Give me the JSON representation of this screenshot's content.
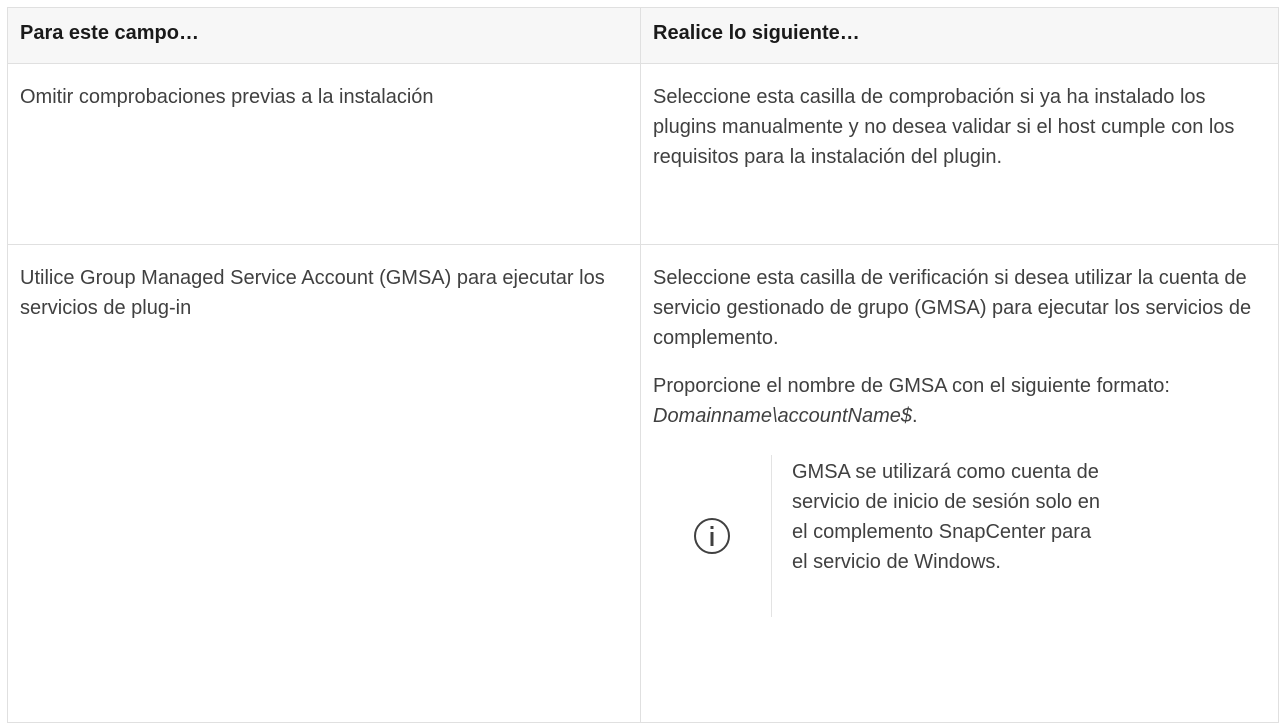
{
  "table": {
    "headers": [
      "Para este campo…",
      "Realice lo siguiente…"
    ],
    "rows": [
      {
        "field": "Omitir comprobaciones previas a la instalación",
        "action": "Seleccione esta casilla de comprobación si ya ha instalado los plugins manualmente y no desea validar si el host cumple con los requisitos para la instalación del plugin."
      },
      {
        "field": "Utilice Group Managed Service Account (GMSA) para ejecutar los servicios de plug-in",
        "action_paragraph_1": "Seleccione esta casilla de verificación si desea utilizar la cuenta de servicio gestionado de grupo (GMSA) para ejecutar los servicios de complemento.",
        "action_paragraph_2_prefix": "Proporcione el nombre de GMSA con el siguiente formato: ",
        "action_paragraph_2_format": "Domainname\\accountName$",
        "action_paragraph_2_suffix": ".",
        "note": {
          "icon": "info-circle-icon",
          "text": "GMSA se utilizará como cuenta de servicio de inicio de sesión solo en el complemento SnapCenter para el servicio de Windows."
        }
      }
    ]
  }
}
